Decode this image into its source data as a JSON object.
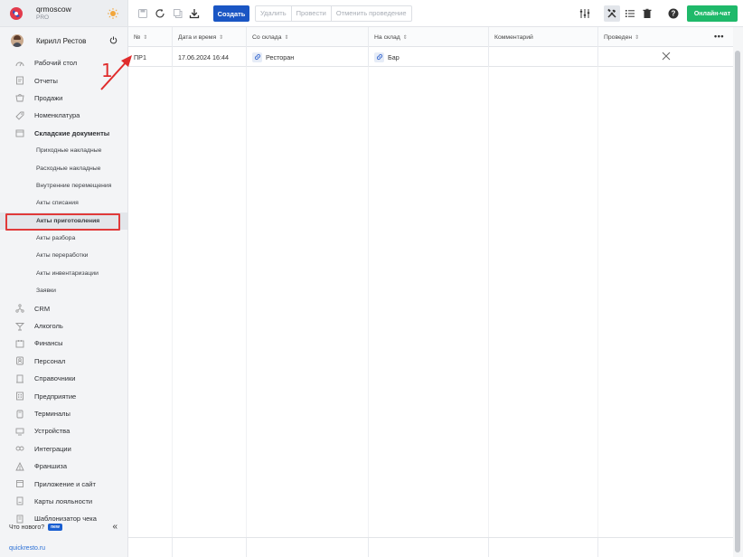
{
  "brand": {
    "name": "qrmoscow",
    "plan": "PRO"
  },
  "user": {
    "name": "Кирилл Рестов"
  },
  "menu": [
    {
      "label": "Рабочий стол",
      "icon": "dashboard-icon"
    },
    {
      "label": "Отчеты",
      "icon": "reports-icon"
    },
    {
      "label": "Продажи",
      "icon": "sales-icon"
    },
    {
      "label": "Номенклатура",
      "icon": "nomenclature-icon"
    },
    {
      "label": "Складские документы",
      "icon": "warehouse-icon"
    },
    {
      "label": "Приходные накладные"
    },
    {
      "label": "Расходные накладные"
    },
    {
      "label": "Внутренние перемещения"
    },
    {
      "label": "Акты списания"
    },
    {
      "label": "Акты приготовления"
    },
    {
      "label": "Акты разбора"
    },
    {
      "label": "Акты переработки"
    },
    {
      "label": "Акты инвентаризации"
    },
    {
      "label": "Заявки"
    },
    {
      "label": "CRM",
      "icon": "crm-icon"
    },
    {
      "label": "Алкоголь",
      "icon": "alcohol-icon"
    },
    {
      "label": "Финансы",
      "icon": "finance-icon"
    },
    {
      "label": "Персонал",
      "icon": "staff-icon"
    },
    {
      "label": "Справочники",
      "icon": "directory-icon"
    },
    {
      "label": "Предприятие",
      "icon": "enterprise-icon"
    },
    {
      "label": "Терминалы",
      "icon": "terminal-icon"
    },
    {
      "label": "Устройства",
      "icon": "devices-icon"
    },
    {
      "label": "Интеграции",
      "icon": "integrations-icon"
    },
    {
      "label": "Франшиза",
      "icon": "franchise-icon"
    },
    {
      "label": "Приложение и сайт",
      "icon": "app-site-icon"
    },
    {
      "label": "Карты лояльности",
      "icon": "loyalty-cards-icon"
    },
    {
      "label": "Шаблонизатор чека",
      "icon": "receipt-template-icon"
    }
  ],
  "footer": {
    "whats_new": "Что нового?",
    "badge": "new",
    "link": "quickresto.ru"
  },
  "toolbar": {
    "create": "Создать",
    "delete": "Удалить",
    "post": "Провести",
    "unpost": "Отменить проведение",
    "chat": "Онлайн-чат"
  },
  "table": {
    "columns": [
      "№",
      "Дата и время",
      "Со склада",
      "На склад",
      "Комментарий",
      "Проведен"
    ],
    "rows": [
      {
        "number": "ПР1",
        "datetime": "17.06.2024 16:44",
        "from": "Ресторан",
        "to": "Бар",
        "comment": "",
        "posted": "no"
      }
    ]
  },
  "annotation": {
    "label": "1"
  },
  "colors": {
    "accent": "#1a56c4",
    "chat": "#1fb96a",
    "highlight": "#e03a3a"
  }
}
